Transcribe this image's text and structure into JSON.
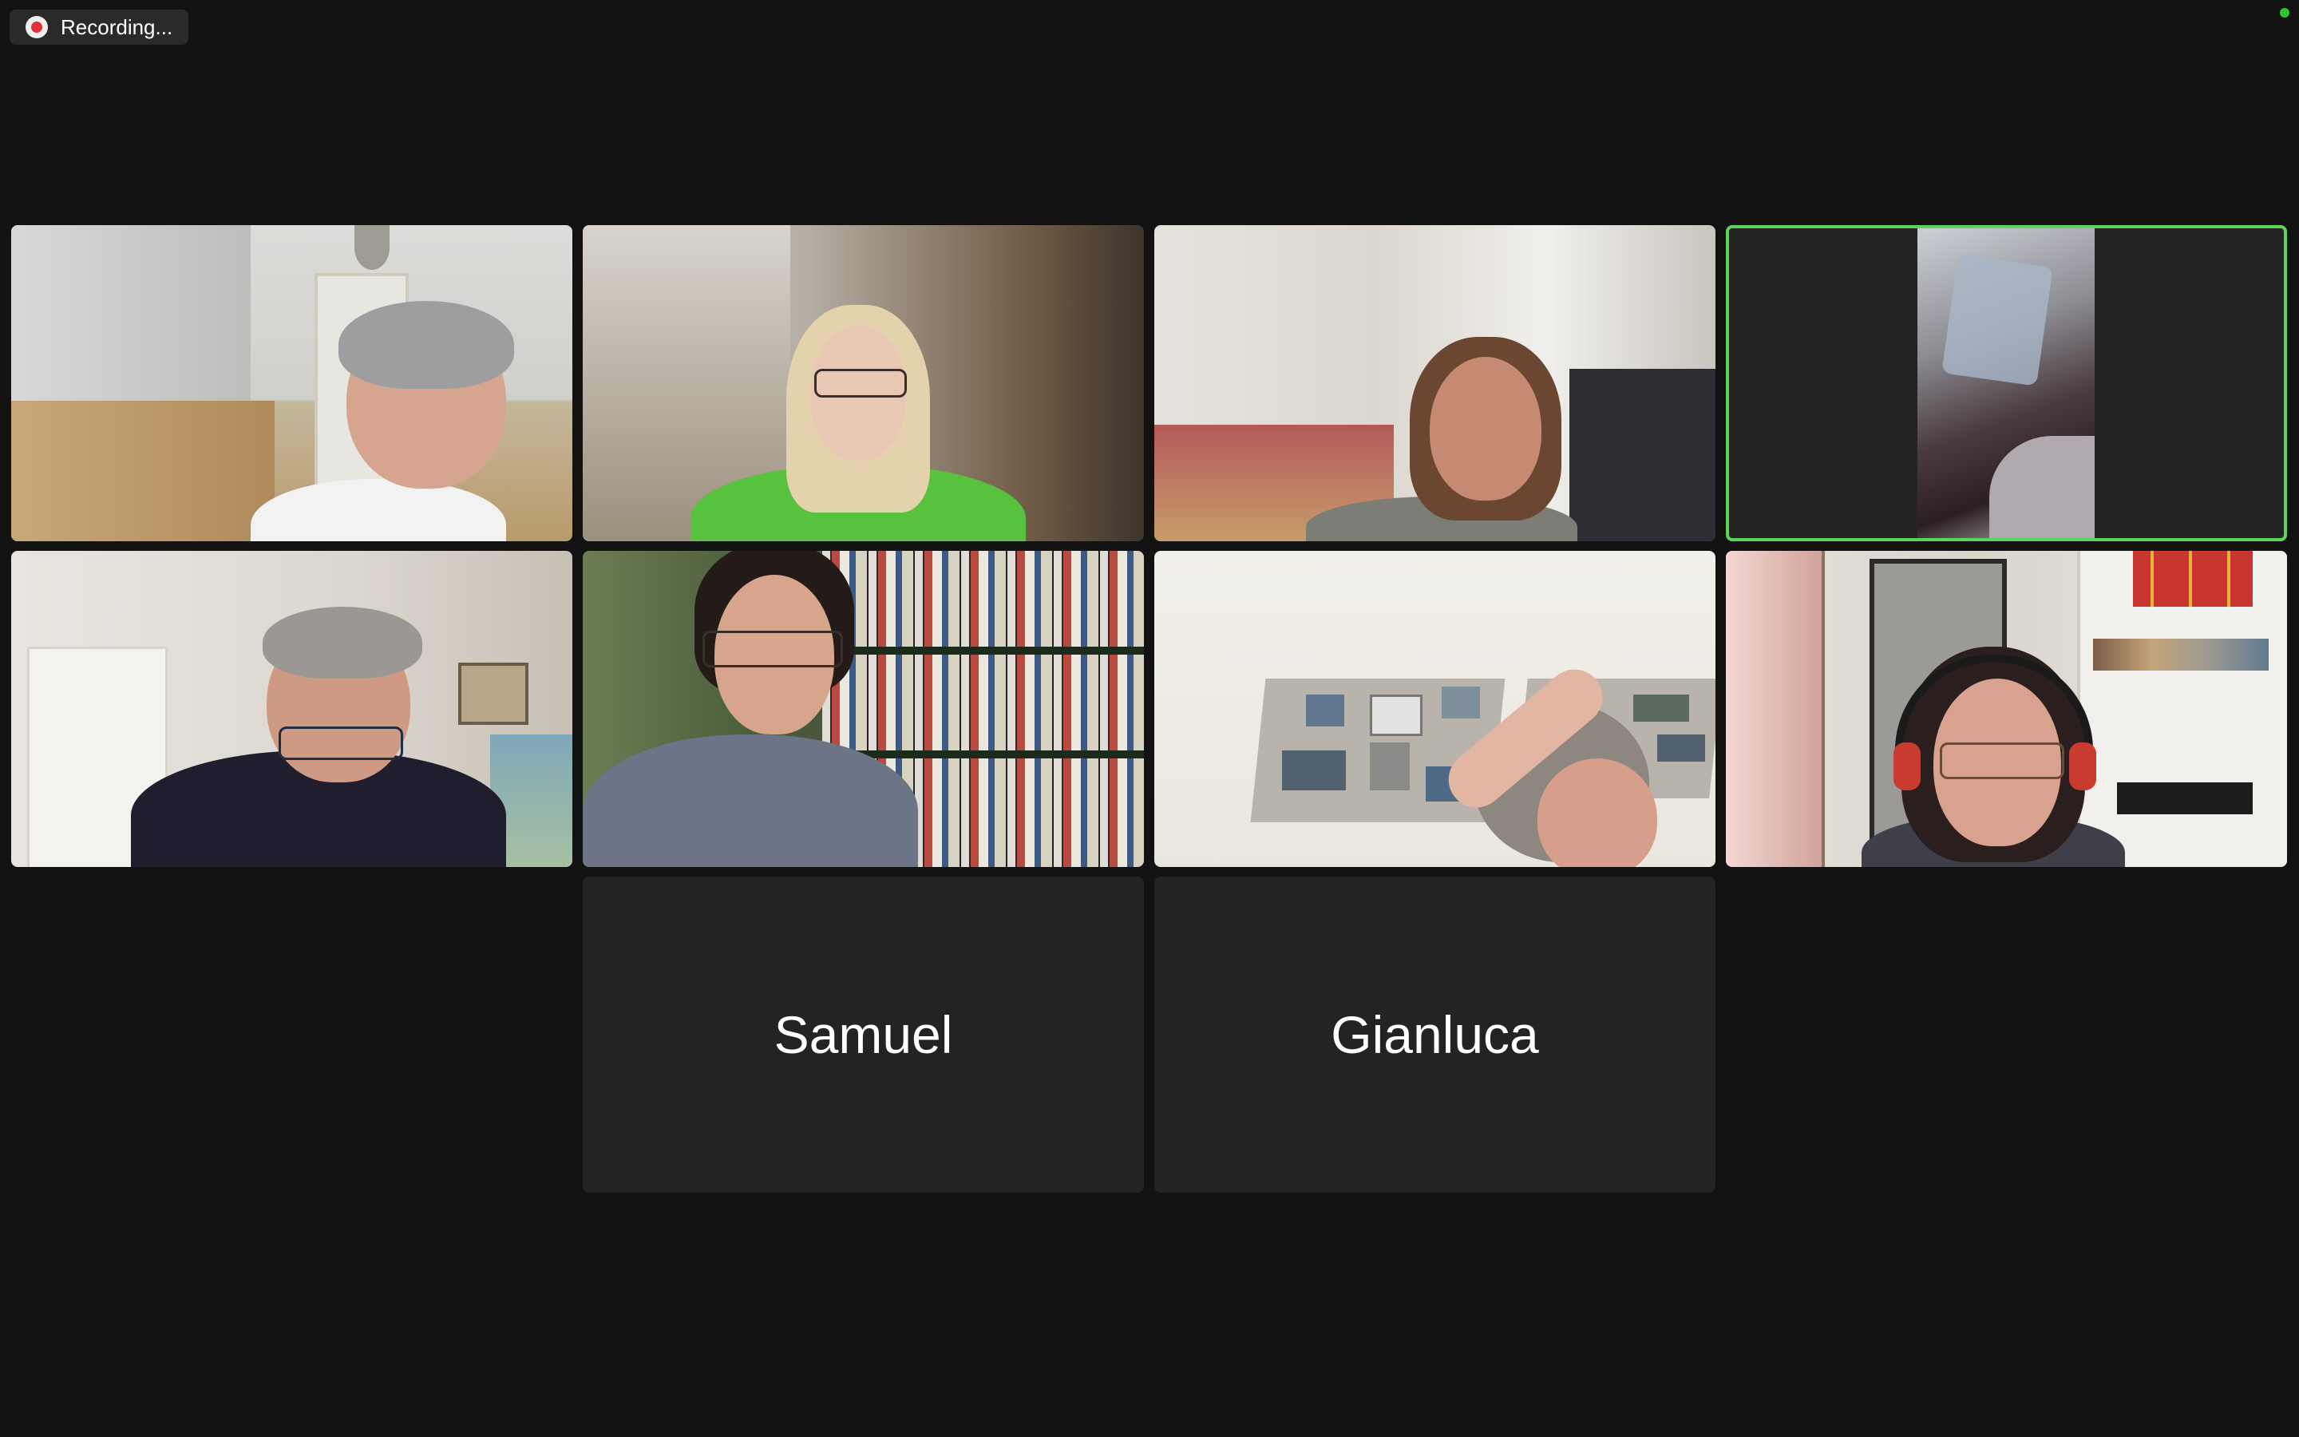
{
  "recording": {
    "label": "Recording...",
    "icon": "record-icon"
  },
  "status": {
    "indicator_color": "#2fc52f"
  },
  "colors": {
    "background": "#121212",
    "tile_background": "#232323",
    "active_speaker_border": "#5ed35a",
    "record_dot": "#e0313b"
  },
  "participants": [
    {
      "name": "",
      "video_on": true
    },
    {
      "name": "",
      "video_on": true
    },
    {
      "name": "",
      "video_on": true
    },
    {
      "name": "",
      "video_on": true,
      "active_speaker": true
    },
    {
      "name": "",
      "video_on": true
    },
    {
      "name": "",
      "video_on": true
    },
    {
      "name": "",
      "video_on": true
    },
    {
      "name": "",
      "video_on": true
    },
    {
      "name": "Samuel",
      "video_on": false
    },
    {
      "name": "Gianluca",
      "video_on": false
    }
  ]
}
